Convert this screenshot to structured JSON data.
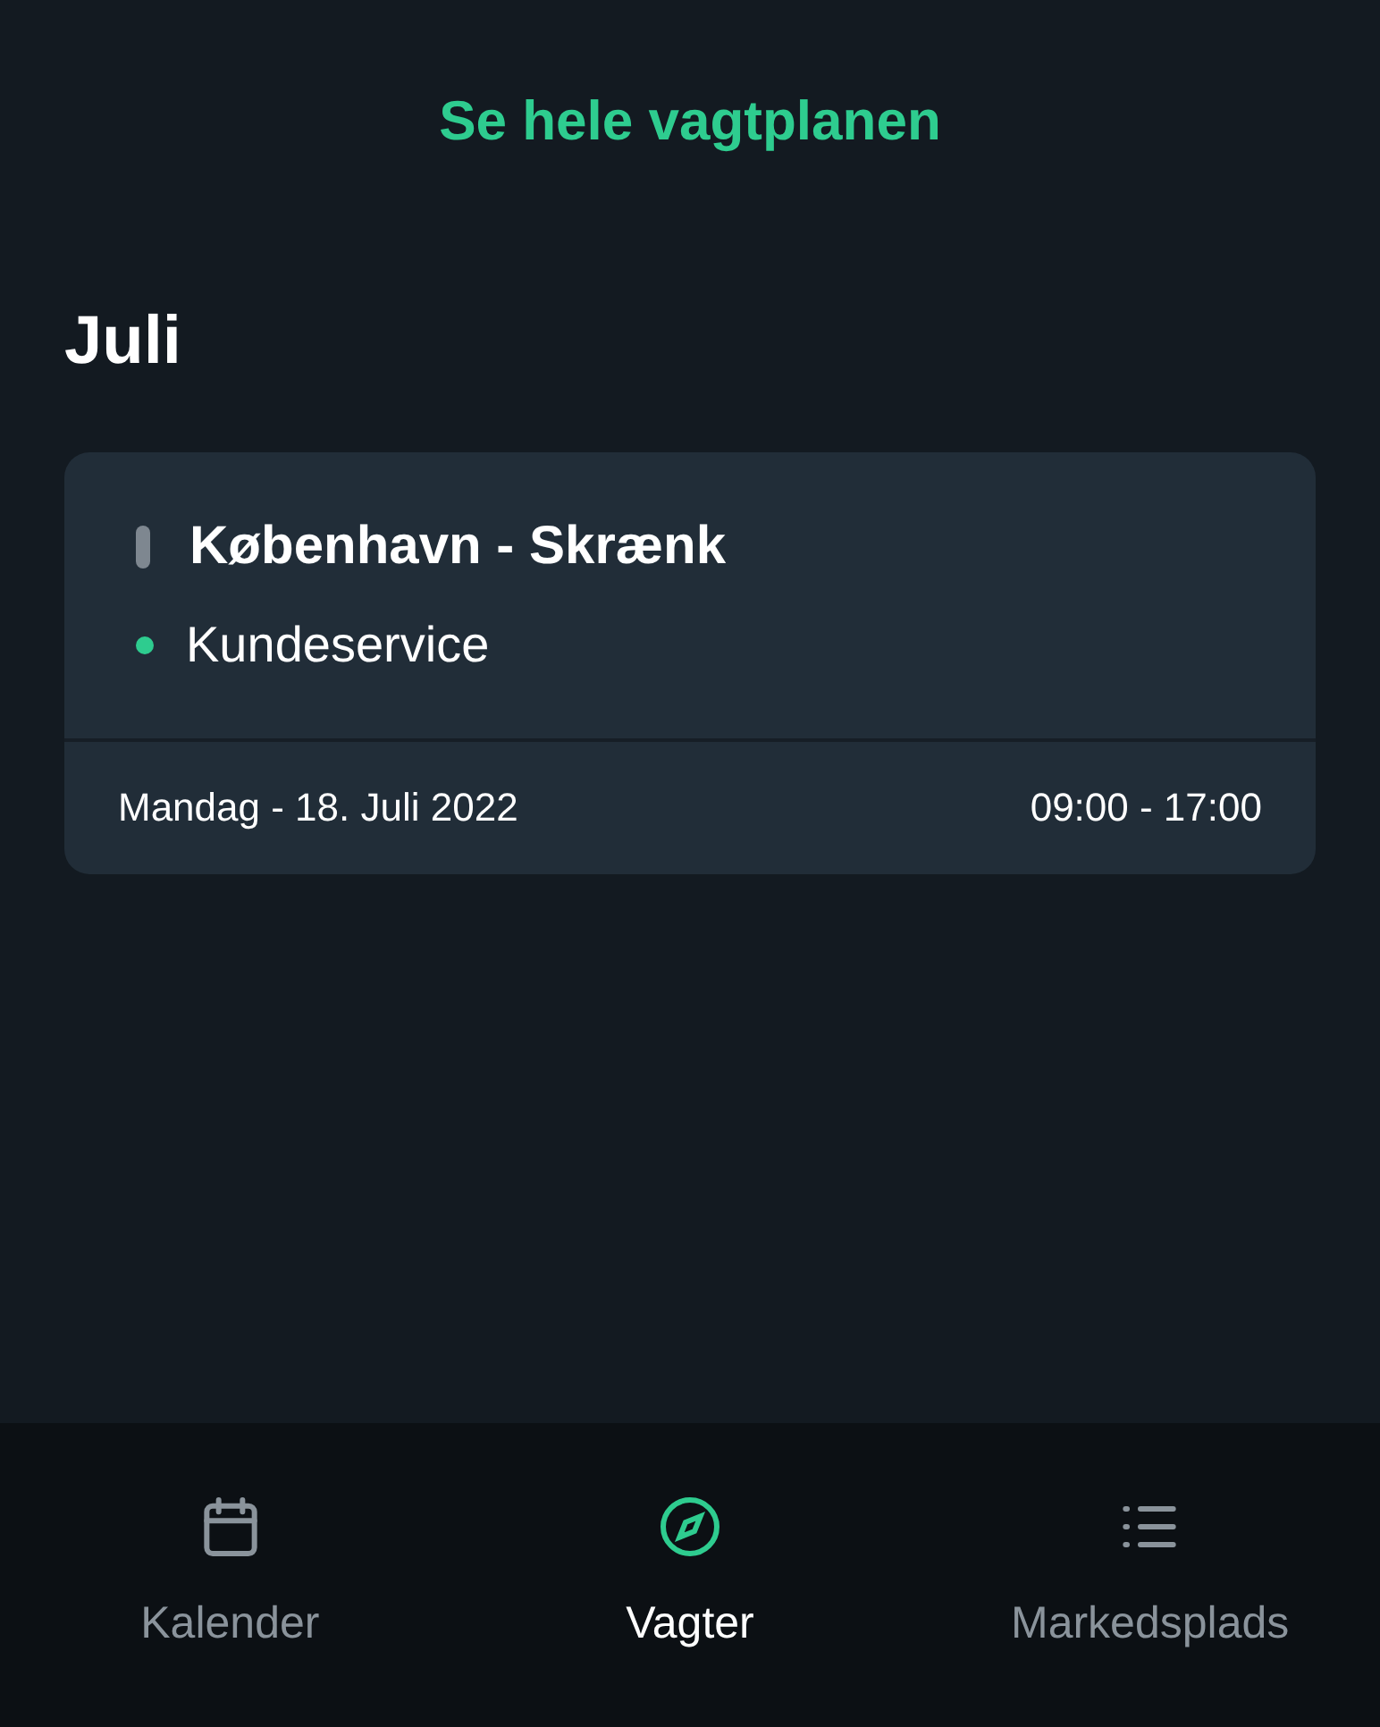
{
  "link": "Se hele vagtplanen",
  "month": "Juli",
  "shifts": [
    {
      "location": "København - Skrænk",
      "department": "Kundeservice",
      "color": "#2ecc8f",
      "date": "Mandag - 18. Juli 2022",
      "time": "09:00 - 17:00"
    }
  ],
  "nav": [
    {
      "label": "Kalender",
      "kind": "calendar",
      "selected": false
    },
    {
      "label": "Vagter",
      "kind": "compass",
      "selected": true
    },
    {
      "label": "Markedsplads",
      "kind": "list",
      "selected": false
    }
  ]
}
